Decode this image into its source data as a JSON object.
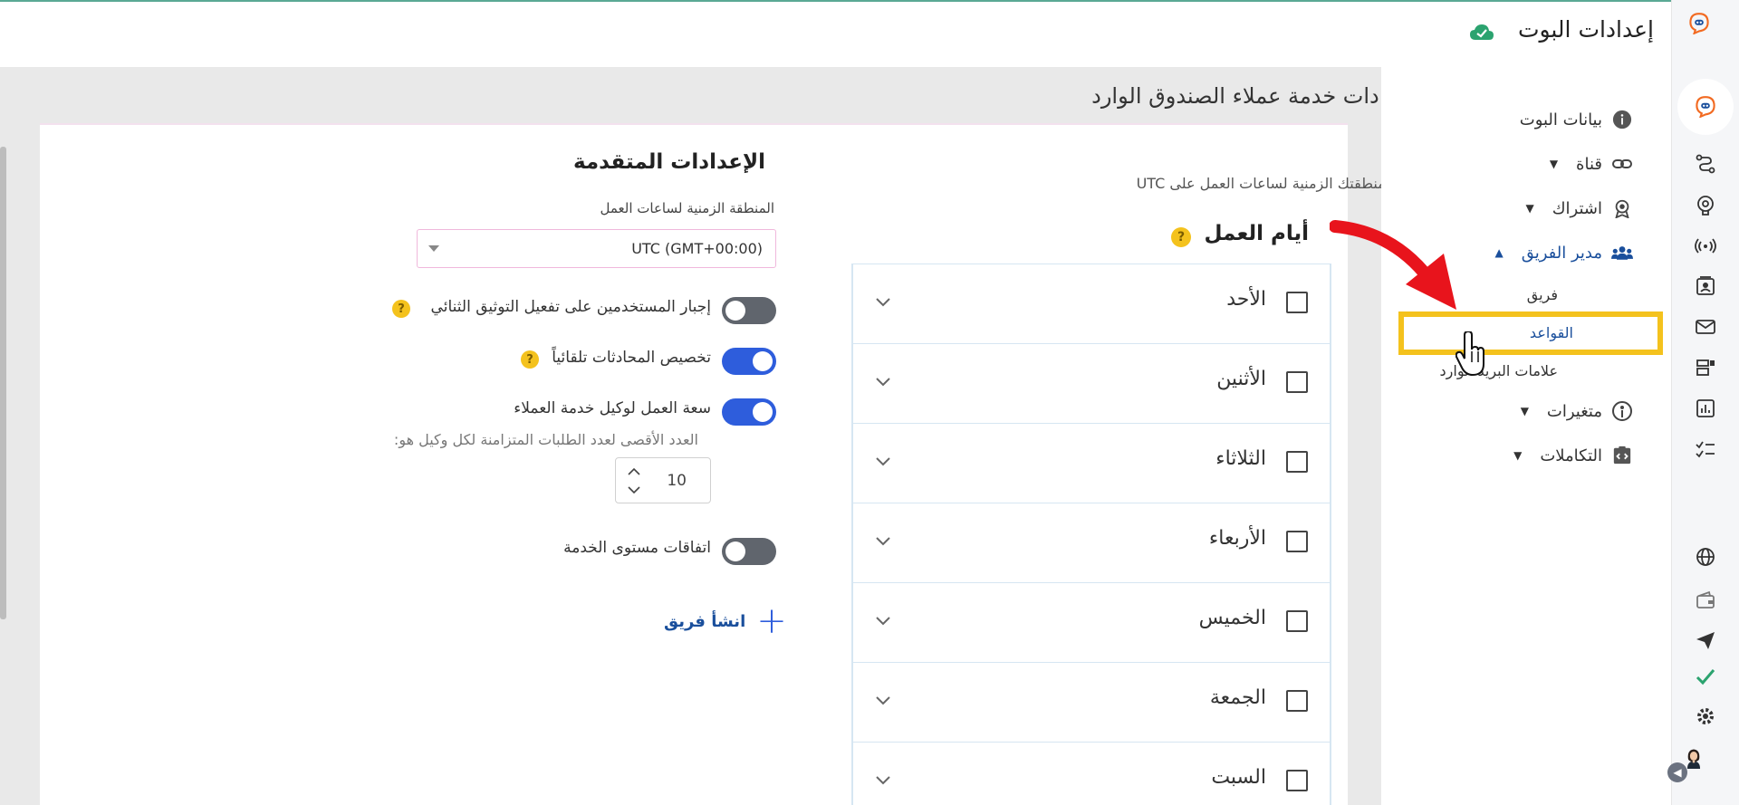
{
  "header": {
    "title": "إعدادات البوت",
    "saved_icon": "cloud-check-icon"
  },
  "sidebar": {
    "items": [
      {
        "label": "بيانات البوت",
        "icon": "info-icon"
      },
      {
        "label": "قناة",
        "icon": "link-icon"
      },
      {
        "label": "اشتراك",
        "icon": "badge-icon"
      },
      {
        "label": "مدير الفريق",
        "icon": "users-icon"
      },
      {
        "label": "متغيرات",
        "icon": "variable-icon"
      },
      {
        "label": "التكاملات",
        "icon": "integration-icon"
      }
    ],
    "team_sub": [
      "فريق",
      "القواعد",
      "علامات البريد الوارد"
    ]
  },
  "page": {
    "title": "إعدادات خدمة عملاء الصندوق الوارد"
  },
  "working_days": {
    "timezone_note": "تم تعيين منطقتك الزمنية لساعات العمل على UTC",
    "title": "أيام العمل",
    "days": [
      "الأحد",
      "الأثنين",
      "الثلاثاء",
      "الأربعاء",
      "الخميس",
      "الجمعة",
      "السبت"
    ]
  },
  "advanced": {
    "title": "الإعدادات المتقدمة",
    "timezone_label": "المنطقة الزمنية لساعات العمل",
    "timezone_value": "UTC (GMT+00:00)",
    "toggles": [
      {
        "label": "إجبار المستخدمين على تفعيل التوثيق الثنائي",
        "on": false
      },
      {
        "label": "تخصيص المحادثات تلقائياً",
        "on": true
      },
      {
        "label": "سعة العمل لوكيل خدمة العملاء",
        "on": true
      },
      {
        "label": "اتفاقات مستوى الخدمة",
        "on": false
      }
    ],
    "capacity_helper": "العدد الأقصى لعدد الطلبات المتزامنة لكل وكيل هو:",
    "capacity_value": "10",
    "create_team": "انشأ فريق"
  },
  "colors": {
    "accent": "#2e5ddc",
    "highlight": "#f4c21d",
    "arrow": "#e8141c",
    "brand": "#f26a21"
  }
}
